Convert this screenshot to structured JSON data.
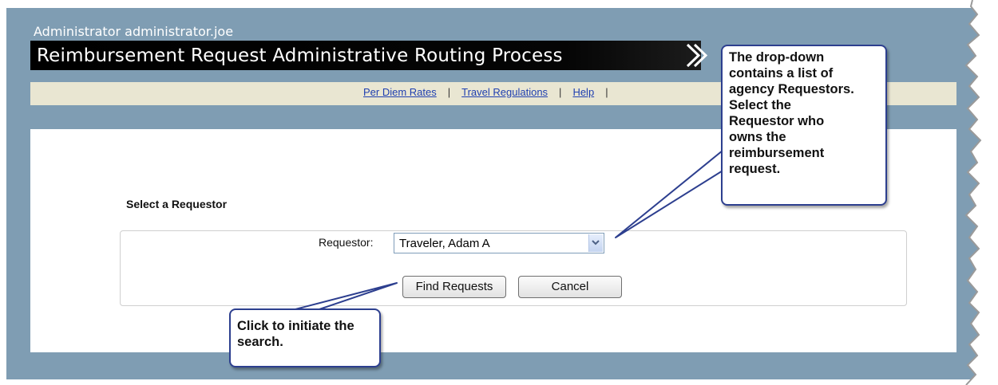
{
  "header": {
    "user": "Administrator administrator.joe",
    "title": "Reimbursement Request Administrative Routing Process"
  },
  "links": {
    "per_diem": "Per Diem Rates",
    "travel_regs": "Travel Regulations",
    "help": "Help",
    "separator": "|"
  },
  "form": {
    "section_title": "Select a Requestor",
    "requestor_label": "Requestor:",
    "requestor_value": "Traveler, Adam A",
    "find_button": "Find Requests",
    "cancel_button": "Cancel"
  },
  "callouts": {
    "dropdown_lines": [
      "The drop-down",
      "contains a list of",
      "agency Requestors.",
      "Select the",
      "Requestor who",
      "owns the",
      "reimbursement",
      "request."
    ],
    "search_lines": [
      "Click to initiate the",
      "search."
    ]
  },
  "colors": {
    "frame": "#7f9db3",
    "header_bar": "#000000",
    "link_bar": "#e9e6d2",
    "link": "#1f3fb0",
    "callout_border": "#2d3f8f"
  },
  "icons": {
    "header_arrow": "double-chevron-right-icon",
    "select_arrow": "chevron-down-icon"
  }
}
